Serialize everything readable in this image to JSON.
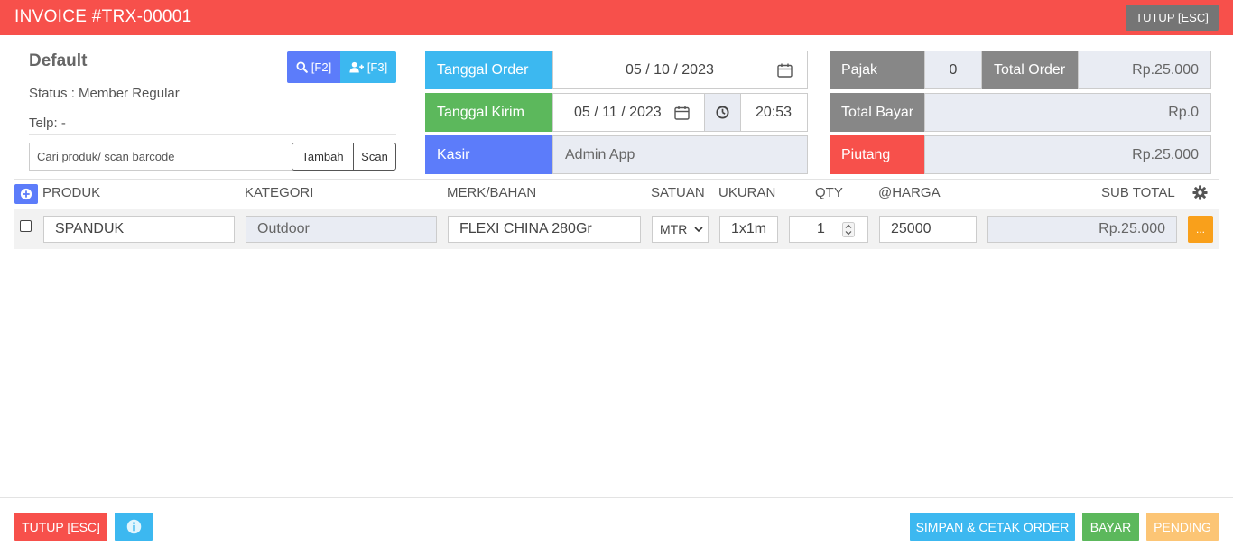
{
  "header": {
    "title": "INVOICE #TRX-00001",
    "close_label": "TUTUP [ESC]"
  },
  "customer": {
    "name": "Default",
    "search_btn_label": "[F2]",
    "add_btn_label": "[F3]",
    "status": "Status : Member Regular",
    "telp": "Telp: -",
    "search_placeholder": "Cari produk/ scan barcode",
    "tambah_label": "Tambah",
    "scan_label": "Scan"
  },
  "order": {
    "tanggal_order_label": "Tanggal Order",
    "tanggal_order_value": "05 / 10 / 2023",
    "tanggal_kirim_label": "Tanggal Kirim",
    "tanggal_kirim_value": "05 / 11 / 2023",
    "jam_kirim": "20:53",
    "kasir_label": "Kasir",
    "kasir_value": "Admin App"
  },
  "summary": {
    "pajak_label": "Pajak",
    "pajak_value": "0",
    "total_order_label": "Total Order",
    "total_order_value": "Rp.25.000",
    "total_bayar_label": "Total Bayar",
    "total_bayar_value": "Rp.0",
    "piutang_label": "Piutang",
    "piutang_value": "Rp.25.000"
  },
  "table": {
    "headers": {
      "produk": "PRODUK",
      "kategori": "KATEGORI",
      "merk": "MERK/BAHAN",
      "satuan": "SATUAN",
      "ukuran": "UKURAN",
      "qty": "QTY",
      "harga": "@HARGA",
      "subtotal": "SUB TOTAL"
    },
    "rows": [
      {
        "produk": "SPANDUK",
        "kategori": "Outdoor",
        "merk": "FLEXI CHINA 280Gr",
        "satuan": "MTR",
        "ukuran": "1x1m",
        "qty": "1",
        "harga": "25000",
        "subtotal": "Rp.25.000",
        "more_label": "..."
      }
    ]
  },
  "footer": {
    "close_label": "TUTUP [ESC]",
    "save_print_label": "SIMPAN & CETAK ORDER",
    "bayar_label": "BAYAR",
    "pending_label": "PENDING"
  },
  "colors": {
    "red": "#f7504b",
    "blue_light": "#3cb8f0",
    "indigo": "#5c7cfa",
    "green": "#5cb85c",
    "gray": "#878787",
    "orange": "#f9a01b",
    "pending": "#fcc575"
  }
}
